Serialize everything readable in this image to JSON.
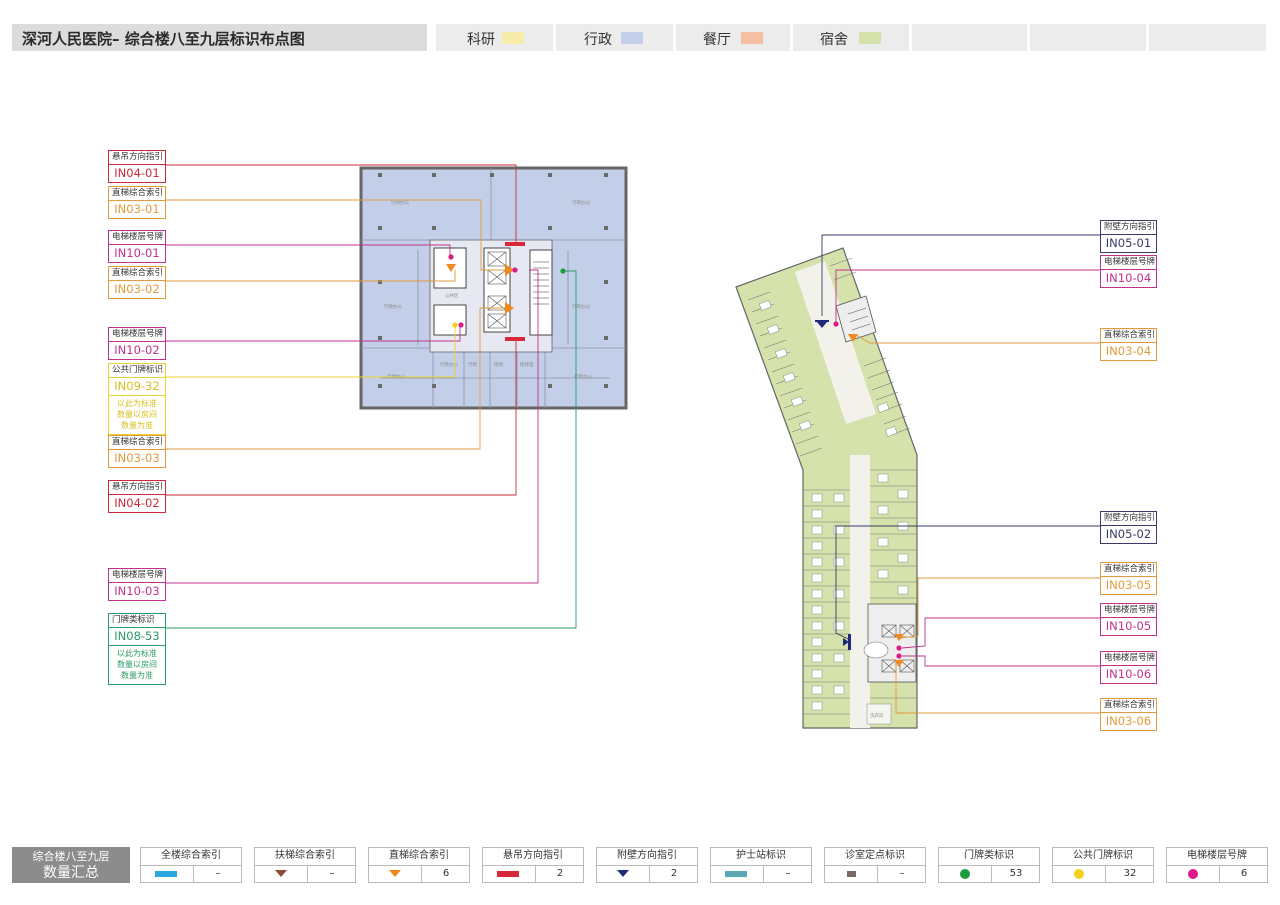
{
  "header": {
    "title": "深河人民医院– 综合楼八至九层标识布点图",
    "legend": [
      {
        "label": "科研",
        "color": "#f7ecaa"
      },
      {
        "label": "行政",
        "color": "#c3cfe8"
      },
      {
        "label": "餐厅",
        "color": "#f5bfa4"
      },
      {
        "label": "宿舍",
        "color": "#d5e2ab"
      }
    ]
  },
  "callouts_left": [
    {
      "title": "悬吊方向指引",
      "code": "IN04-01",
      "color": "#cc2a3a"
    },
    {
      "title": "直梯综合索引",
      "code": "IN03-01",
      "color": "#e39a3c"
    },
    {
      "title": "电梯楼层号牌",
      "code": "IN10-01",
      "color": "#c2318f"
    },
    {
      "title": "直梯综合索引",
      "code": "IN03-02",
      "color": "#e39a3c"
    },
    {
      "title": "电梯楼层号牌",
      "code": "IN10-02",
      "color": "#c2318f"
    },
    {
      "title": "公共门牌标识",
      "code": "IN09-32",
      "color": "#ecd22e",
      "note": "以此为标准\n数量以房间\n数量为准"
    },
    {
      "title": "直梯综合索引",
      "code": "IN03-03",
      "color": "#e39a3c"
    },
    {
      "title": "悬吊方向指引",
      "code": "IN04-02",
      "color": "#cc2a3a"
    },
    {
      "title": "电梯楼层号牌",
      "code": "IN10-03",
      "color": "#c2318f"
    },
    {
      "title": "门牌类标识",
      "code": "IN08-53",
      "color": "#2c9a66",
      "note": "以此为标准\n数量以房间\n数量为准"
    }
  ],
  "callouts_right": [
    {
      "title": "附壁方向指引",
      "code": "IN05-01",
      "color": "#3a3a6a"
    },
    {
      "title": "电梯楼层号牌",
      "code": "IN10-04",
      "color": "#c2318f"
    },
    {
      "title": "直梯综合索引",
      "code": "IN03-04",
      "color": "#e39a3c"
    },
    {
      "title": "附壁方向指引",
      "code": "IN05-02",
      "color": "#3a3a6a"
    },
    {
      "title": "直梯综合索引",
      "code": "IN03-05",
      "color": "#e39a3c"
    },
    {
      "title": "电梯楼层号牌",
      "code": "IN10-05",
      "color": "#c2318f"
    },
    {
      "title": "电梯楼层号牌",
      "code": "IN10-06",
      "color": "#c2318f"
    },
    {
      "title": "直梯综合索引",
      "code": "IN03-06",
      "color": "#e39a3c"
    }
  ],
  "summary": {
    "title_line1": "综合楼八至九层",
    "title_line2": "数量汇总",
    "items": [
      {
        "name": "全楼综合索引",
        "count": "–",
        "icon": "bar",
        "color": "#2aa8e0"
      },
      {
        "name": "扶梯综合索引",
        "count": "–",
        "icon": "tri",
        "color": "#8a4a3a"
      },
      {
        "name": "直梯综合索引",
        "count": "6",
        "icon": "tri",
        "color": "#f08a1e"
      },
      {
        "name": "悬吊方向指引",
        "count": "2",
        "icon": "bar",
        "color": "#d6283a"
      },
      {
        "name": "附壁方向指引",
        "count": "2",
        "icon": "tri",
        "color": "#1e2a78"
      },
      {
        "name": "护士站标识",
        "count": "–",
        "icon": "bar",
        "color": "#5aa8b4"
      },
      {
        "name": "诊室定点标识",
        "count": "–",
        "icon": "sq",
        "color": "#7a6a66"
      },
      {
        "name": "门牌类标识",
        "count": "53",
        "icon": "dot",
        "color": "#1e9a3e"
      },
      {
        "name": "公共门牌标识",
        "count": "32",
        "icon": "dot",
        "color": "#f2d21e"
      },
      {
        "name": "电梯楼层号牌",
        "count": "6",
        "icon": "dot",
        "color": "#e0198a"
      }
    ]
  }
}
